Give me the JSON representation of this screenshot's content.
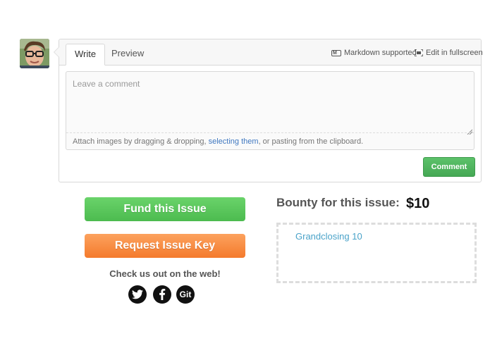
{
  "editor": {
    "tabs": [
      "Write",
      "Preview"
    ],
    "markdown_label": "Markdown supported",
    "fullscreen_label": "Edit in fullscreen",
    "placeholder": "Leave a comment",
    "value": "",
    "attach_prefix": "Attach images by dragging & dropping, ",
    "attach_link": "selecting them",
    "attach_suffix": ", or pasting from the clipboard.",
    "comment_button": "Comment"
  },
  "actions": {
    "fund_label": "Fund this Issue",
    "request_label": "Request Issue Key",
    "check_web": "Check us out on the web!",
    "social_icons": [
      "twitter-icon",
      "facebook-icon",
      "github-icon"
    ],
    "github_text": "Git"
  },
  "bounty": {
    "label": "Bounty for this issue:",
    "amount": "$10",
    "items": [
      "Grandclosing 10"
    ]
  },
  "colors": {
    "fund_green": "#5cc95c",
    "request_orange": "#f98d45",
    "comment_green": "#4fb45c",
    "link_blue": "#4078c0",
    "bounty_link": "#4aa3c9"
  }
}
